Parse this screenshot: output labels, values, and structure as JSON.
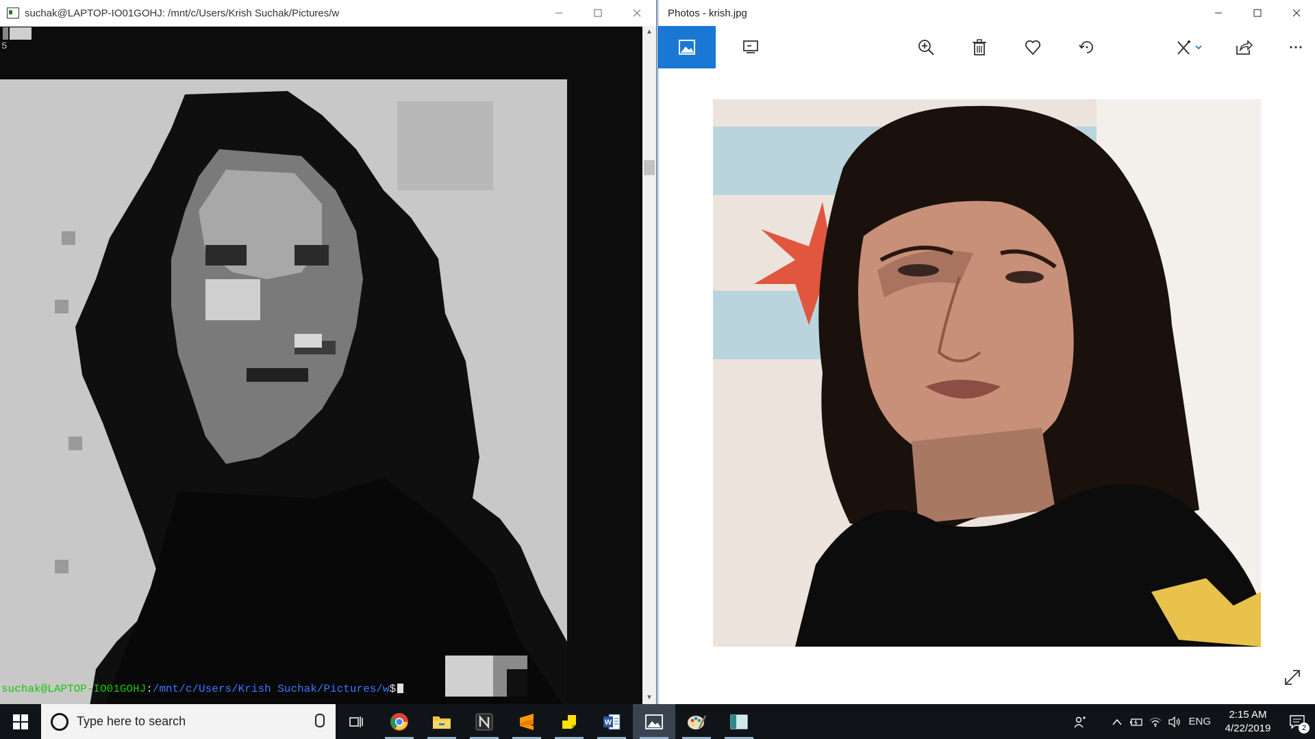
{
  "terminal": {
    "title": "suchak@LAPTOP-IO01GOHJ: /mnt/c/Users/Krish Suchak/Pictures/w",
    "output_line": "5",
    "prompt_user": "suchak@LAPTOP-IO01GOHJ",
    "prompt_sep": ":",
    "prompt_path": "/mnt/c/Users/Krish Suchak/Pictures/w",
    "prompt_symbol": "$"
  },
  "photos": {
    "title": "Photos - krish.jpg",
    "colors": {
      "accent": "#1a78d4"
    }
  },
  "taskbar": {
    "search_placeholder": "Type here to search",
    "apps": [
      "chrome-icon",
      "file-explorer-icon",
      "notion-icon",
      "sublime-text-icon",
      "sticky-notes-icon",
      "word-icon",
      "photos-icon",
      "paint-icon",
      "app-window-icon"
    ],
    "language": "ENG",
    "time": "2:15 AM",
    "date": "4/22/2019",
    "notification_count": "2"
  }
}
